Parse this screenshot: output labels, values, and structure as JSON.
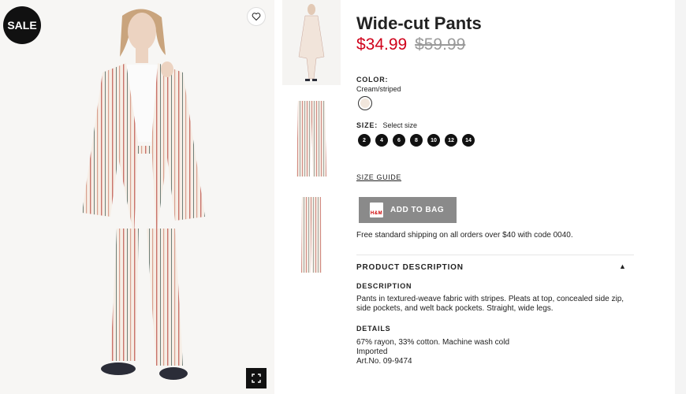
{
  "badge": {
    "sale": "SALE"
  },
  "product": {
    "title": "Wide-cut Pants",
    "price_sale": "$34.99",
    "price_original": "$59.99"
  },
  "color": {
    "label": "COLOR:",
    "value": "Cream/striped",
    "swatch_color": "#f1e6dc"
  },
  "size": {
    "label": "SIZE:",
    "prompt": "Select size",
    "options": [
      "2",
      "4",
      "6",
      "8",
      "10",
      "12",
      "14"
    ]
  },
  "size_guide": "SIZE GUIDE",
  "add_to_bag": {
    "label": "ADD TO BAG",
    "icon_text": "H&M"
  },
  "shipping_note": "Free standard shipping on all orders over $40 with code 0040.",
  "product_description": {
    "heading": "PRODUCT DESCRIPTION",
    "toggle_icon": "▲",
    "description_heading": "DESCRIPTION",
    "description_text": "Pants in textured-weave fabric with stripes. Pleats at top, concealed side zip, side pockets, and welt back pockets. Straight, wide legs.",
    "details_heading": "DETAILS",
    "details_lines": [
      "67% rayon, 33% cotton. Machine wash cold",
      "Imported",
      "Art.No. 09-9474"
    ]
  },
  "icons": {
    "wishlist": "heart-icon",
    "fullscreen": "expand-icon",
    "bag": "shopping-bag-icon"
  },
  "colors": {
    "sale_price": "#d0021b",
    "button_bg": "#8a8a8a",
    "old_price": "#9a9a9a"
  }
}
